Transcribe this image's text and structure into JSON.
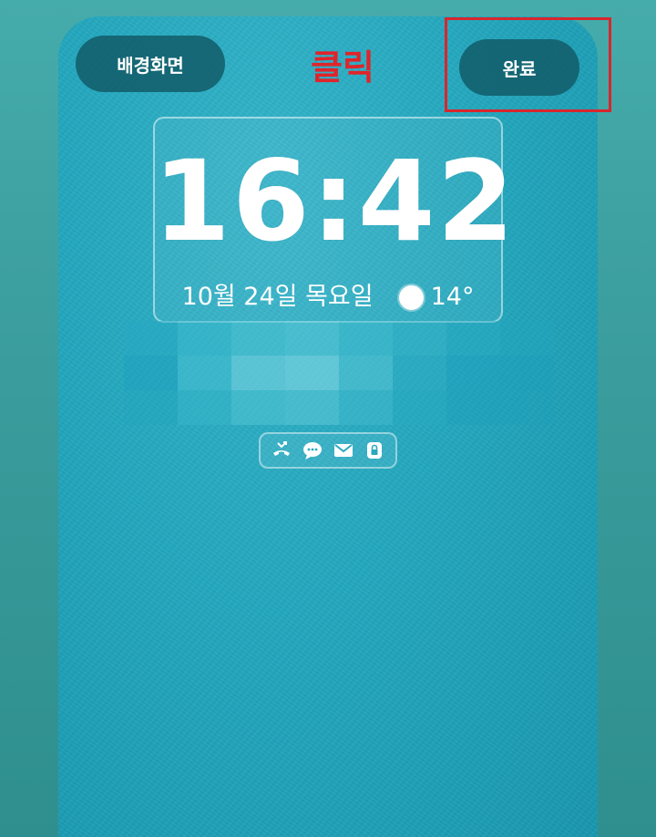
{
  "lockscreen": {
    "wallpaper_button_label": "배경화면",
    "done_button_label": "완료",
    "time": "16:42",
    "date": "10월 24일 목요일",
    "temperature": "14°"
  },
  "annotation": {
    "click_label": "클릭",
    "highlight_color": "#d9262c"
  },
  "notification_icons": [
    "missed-call-icon",
    "message-icon",
    "mail-icon",
    "lock-icon"
  ],
  "colors": {
    "wallpaper": "#23a7be",
    "button_bg": "#125c68",
    "annotation_red": "#e0242b"
  }
}
